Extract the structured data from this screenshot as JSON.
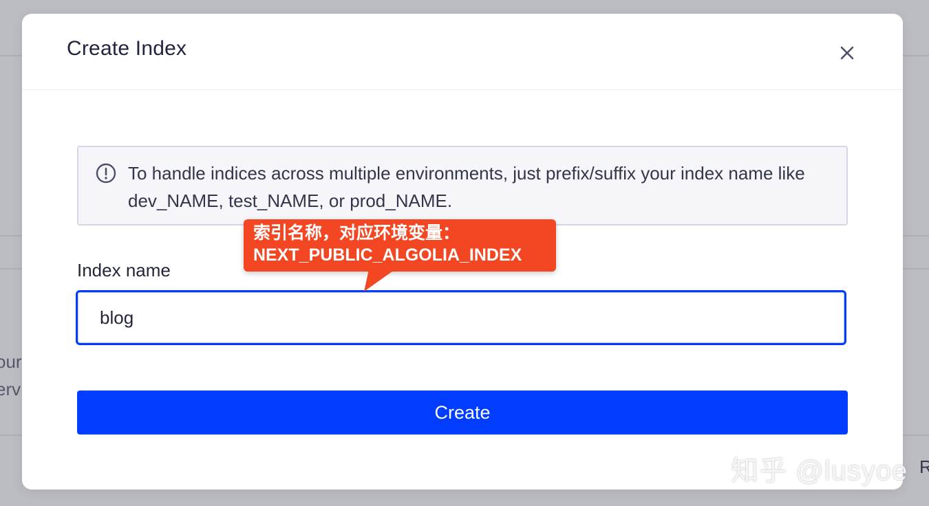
{
  "background": {
    "left_text_lines": [
      "our",
      "erv"
    ],
    "right_text": "R"
  },
  "modal": {
    "title": "Create Index",
    "close_icon": "close-icon",
    "notice": {
      "icon": "info-circle-icon",
      "text": "To handle indices across multiple environments, just prefix/suffix your index name like dev_NAME, test_NAME, or prod_NAME."
    },
    "index_field": {
      "label": "Index name",
      "value": "blog"
    },
    "create_button_label": "Create"
  },
  "annotation": {
    "line1": "索引名称，对应环境变量：",
    "line2": "NEXT_PUBLIC_ALGOLIA_INDEX"
  },
  "watermark": "知乎 @lusyoe",
  "colors": {
    "accent": "#003dff",
    "annotation": "#f24722",
    "overlay": "#bcbcc3"
  }
}
